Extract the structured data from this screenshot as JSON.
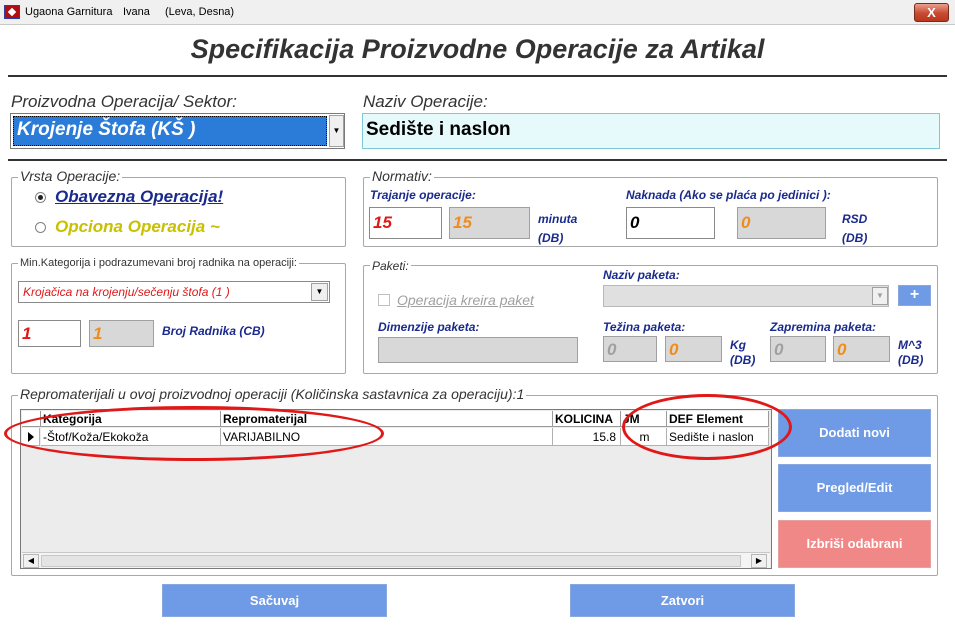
{
  "window": {
    "title": "Ugaona Garnitura",
    "title_user": "Ivana",
    "title_variant": "(Leva, Desna)",
    "close_glyph": "X"
  },
  "page_heading": "Specifikacija Proizvodne Operacije za Artikal",
  "operation": {
    "label": "Proizvodna Operacija/ Sektor:",
    "selected": "Krojenje Štofa (KŠ )",
    "name_label": "Naziv Operacije:",
    "name_value": "Sedište i naslon"
  },
  "vrsta": {
    "legend": "Vrsta Operacije:",
    "options": [
      {
        "label": "Obavezna Operacija!",
        "selected": true
      },
      {
        "label": "Opciona Operacija ~",
        "selected": false
      }
    ]
  },
  "normativ": {
    "legend": "Normativ:",
    "duration_label": "Trajanje operacije:",
    "duration_value": "15",
    "duration_db": "15",
    "unit_minuta": "minuta",
    "unit_db": "(DB)",
    "fee_label": "Naknada (Ako se plaća po jedinici ):",
    "fee_value": "0",
    "fee_db": "0",
    "fee_currency": "RSD",
    "fee_db_label": "(DB)"
  },
  "workers": {
    "legend": "Min.Kategorija i podrazumevani broj radnika na operaciji:",
    "category": "Krojačica na krojenju/sečenju štofa (1 )",
    "count": "1",
    "count_db": "1",
    "count_label": "Broj Radnika (CB)"
  },
  "paketi": {
    "legend": "Paketi:",
    "creates_label": "Operacija kreira paket",
    "creates_checked": false,
    "name_label": "Naziv paketa:",
    "name_value": "",
    "add_glyph": "+",
    "dim_label": "Dimenzije paketa:",
    "dim_value": "",
    "weight_label": "Težina paketa:",
    "weight_value": "0",
    "weight_db": "0",
    "weight_unit": "Kg",
    "weight_db_label": "(DB)",
    "volume_label": "Zapremina paketa:",
    "volume_value": "0",
    "volume_db": "0",
    "volume_unit": "M^3",
    "volume_db_label": "(DB)"
  },
  "materials": {
    "legend": "Repromaterijali u ovoj proizvodnoj operaciji (Količinska sastavnica za operaciju):1",
    "columns": [
      "Kategorija",
      "Repromaterijal",
      "KOLICINA",
      "JM",
      "DEF Element"
    ],
    "rows": [
      [
        "-Štof/Koža/Ekokoža",
        "VARIJABILNO",
        "15.8",
        "m",
        "Sedište i naslon"
      ]
    ]
  },
  "buttons": {
    "add_new": "Dodati novi",
    "review_edit": "Pregled/Edit",
    "delete_selected": "Izbriši odabrani",
    "save": "Sačuvaj",
    "close": "Zatvori"
  },
  "colors": {
    "accent_blue": "#6e9ae6",
    "delete_pink": "#f08888",
    "highlight_red": "#e01818",
    "selection_blue": "#2b7bd8"
  }
}
